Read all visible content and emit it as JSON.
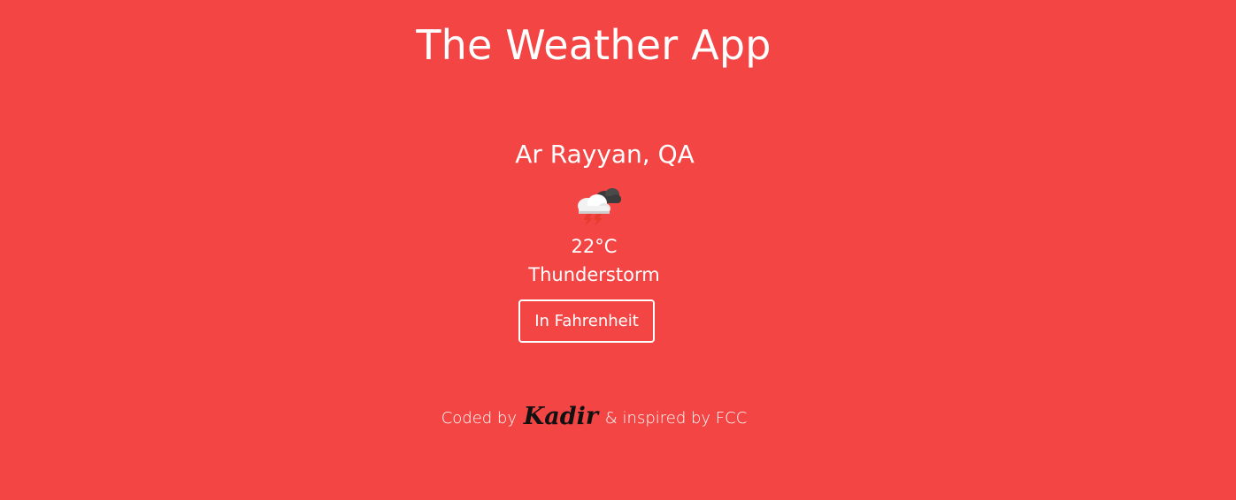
{
  "header": {
    "title": "The Weather App"
  },
  "weather": {
    "location": "Ar Rayyan, QA",
    "icon": "thunderstorm-icon",
    "temperature": "22°C",
    "condition": "Thunderstorm",
    "unit_button_label": "In Fahrenheit"
  },
  "footer": {
    "prefix": "Coded by",
    "author": "Kadir",
    "suffix": "& inspired by FCC"
  },
  "colors": {
    "background": "#f44545",
    "text": "#ffffff",
    "author": "#111111"
  }
}
